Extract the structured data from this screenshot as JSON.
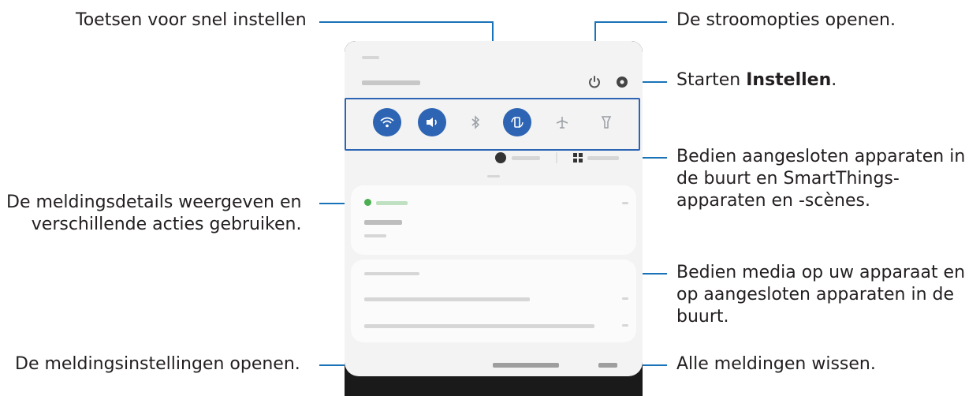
{
  "callouts": {
    "quick_settings": "Toetsen voor snel instellen",
    "notification_details_1": "De meldingsdetails weergeven en",
    "notification_details_2": "verschillende acties gebruiken.",
    "notification_settings": "De meldingsinstellingen openen.",
    "power_options": "De stroomopties openen.",
    "settings_prefix": "Starten ",
    "settings_bold": "Instellen",
    "settings_suffix": ".",
    "devices_1": "Bedien aangesloten apparaten in",
    "devices_2": "de buurt en SmartThings-",
    "devices_3": "apparaten en -scènes.",
    "media_1": "Bedien media op uw apparaat en",
    "media_2": "op aangesloten apparaten in de",
    "media_3": "buurt.",
    "clear_all": "Alle meldingen wissen."
  },
  "icons": {
    "power": "power-icon",
    "settings": "gear-icon",
    "wifi": "wifi-icon",
    "sound": "speaker-icon",
    "bluetooth": "bluetooth-icon",
    "autorotate": "rotate-icon",
    "airplane": "airplane-icon",
    "flashlight": "flashlight-icon",
    "media": "media-icon",
    "devices": "devices-icon"
  },
  "colors": {
    "accent": "#2d64b3",
    "callout_line": "#1a73b8"
  }
}
